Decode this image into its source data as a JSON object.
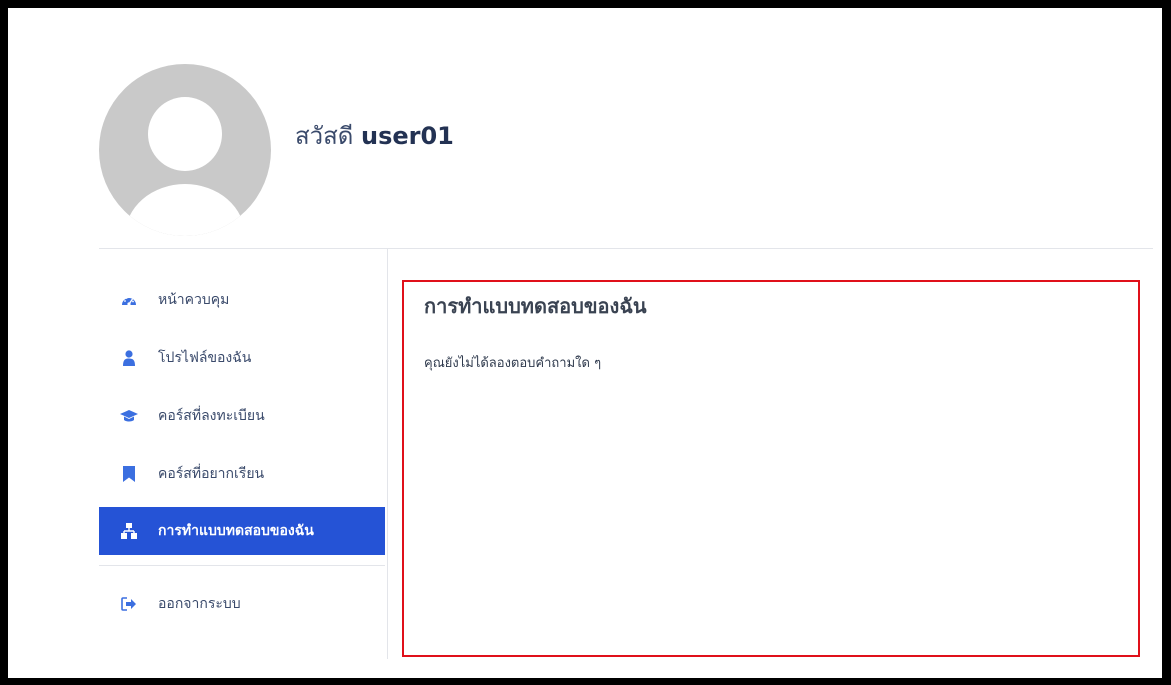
{
  "profile": {
    "greeting": "สวัสดี",
    "username": "user01",
    "avatar_icon": "user-avatar-icon"
  },
  "sidebar": {
    "items": [
      {
        "label": "หน้าควบคุม",
        "icon": "dashboard-icon",
        "active": false
      },
      {
        "label": "โปรไฟล์ของฉัน",
        "icon": "user-icon",
        "active": false
      },
      {
        "label": "คอร์สที่ลงทะเบียน",
        "icon": "graduation-cap-icon",
        "active": false
      },
      {
        "label": "คอร์สที่อยากเรียน",
        "icon": "bookmark-icon",
        "active": false
      },
      {
        "label": "การทำแบบทดสอบของฉัน",
        "icon": "sitemap-icon",
        "active": true
      }
    ],
    "logout_label": "ออกจากระบบ",
    "logout_icon": "sign-out-icon"
  },
  "main": {
    "title": "การทำแบบทดสอบของฉัน",
    "message": "คุณยังไม่ได้ลองตอบคำถามใด ๆ"
  },
  "colors": {
    "accent": "#2553d6",
    "icon": "#3b6fe0",
    "highlight_border": "#e0101a",
    "avatar_bg": "#c9c9c9"
  }
}
